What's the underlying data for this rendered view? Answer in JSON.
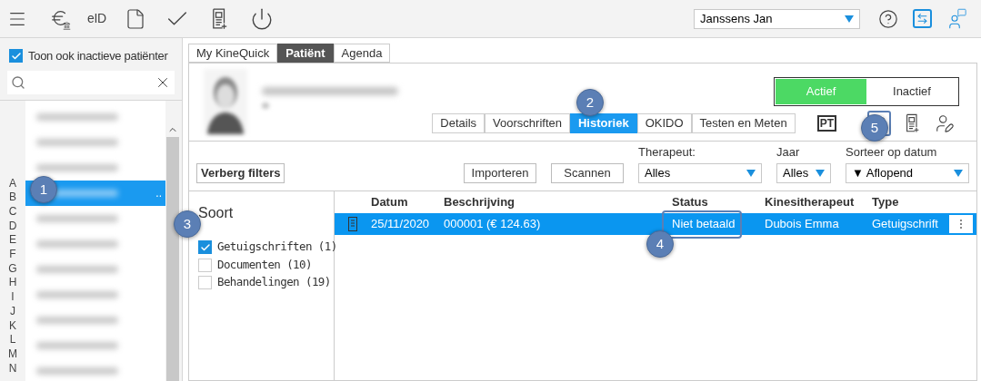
{
  "toolbar": {
    "eid_label": "eID",
    "user_select": {
      "value": "Janssens Jan"
    }
  },
  "sidebar": {
    "show_inactive": {
      "label": "Toon ook inactieve patiënter",
      "checked": true
    },
    "patients": [
      {
        "selected": false
      },
      {
        "selected": false
      },
      {
        "selected": false
      },
      {
        "selected": true
      },
      {
        "selected": false
      },
      {
        "selected": false
      },
      {
        "selected": false
      },
      {
        "selected": false
      },
      {
        "selected": false
      },
      {
        "selected": false
      },
      {
        "selected": false
      }
    ],
    "overflow_mark": "..",
    "letters": [
      "A",
      "B",
      "C",
      "D",
      "E",
      "F",
      "G",
      "H",
      "I",
      "J",
      "K",
      "L",
      "M",
      "N"
    ]
  },
  "main_tabs": [
    {
      "label": "My KineQuick",
      "selected": false
    },
    {
      "label": "Patiënt",
      "selected": true
    },
    {
      "label": "Agenda",
      "selected": false
    }
  ],
  "status_toggle": [
    {
      "label": "Actief",
      "selected": true
    },
    {
      "label": "Inactief",
      "selected": false
    }
  ],
  "sub_tabs": [
    {
      "label": "Details",
      "selected": false
    },
    {
      "label": "Voorschriften",
      "selected": false
    },
    {
      "label": "Historiek",
      "selected": true
    },
    {
      "label": "OKIDO",
      "selected": false
    },
    {
      "label": "Testen en Meten",
      "selected": false
    }
  ],
  "pt_label": "PT",
  "filters": {
    "hide_button": "Verberg filters",
    "buttons": [
      "Importeren",
      "Scannen"
    ],
    "selects": [
      {
        "label": "Therapeut:",
        "value": "Alles",
        "kind": "wide"
      },
      {
        "label": "Jaar",
        "value": "Alles",
        "kind": "narrow"
      },
      {
        "label": "Sorteer op datum",
        "value": "▼ Aflopend",
        "kind": "wide"
      }
    ]
  },
  "soort": {
    "title": "Soort",
    "items": [
      {
        "label": "Getuigschriften (1)",
        "checked": true
      },
      {
        "label": "Documenten (10)",
        "checked": false
      },
      {
        "label": "Behandelingen (19)",
        "checked": false
      }
    ]
  },
  "table": {
    "columns": [
      "Datum",
      "Beschrijving",
      "Status",
      "Kinesitherapeut",
      "Type"
    ],
    "rows": [
      {
        "selected": true,
        "cells": [
          "25/11/2020",
          "000001 (€ 124.63)",
          "Niet betaald",
          "Dubois Emma",
          "Getuigschrift"
        ]
      }
    ]
  },
  "callouts": [
    "1",
    "2",
    "3",
    "4",
    "5"
  ]
}
